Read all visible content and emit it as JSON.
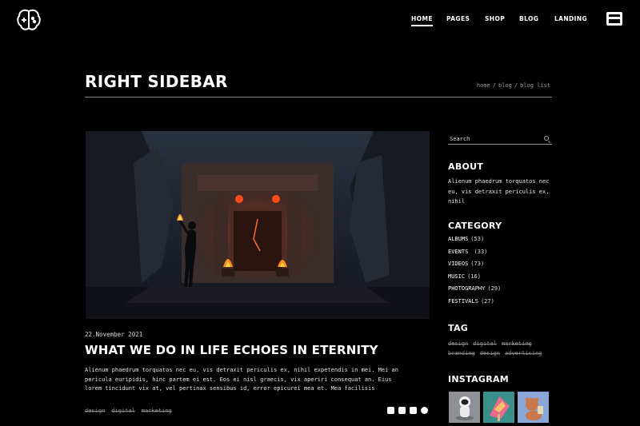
{
  "nav": {
    "items": [
      {
        "label": "HOME",
        "active": true
      },
      {
        "label": "PAGES"
      },
      {
        "label": "SHOP"
      },
      {
        "label": "BLOG"
      },
      {
        "label": "LANDING"
      }
    ]
  },
  "page": {
    "title": "RIGHT SIDEBAR",
    "breadcrumb": [
      "home",
      "blog",
      "blog list"
    ],
    "breadcrumb_separator": "/"
  },
  "post": {
    "date": "22.November 2021",
    "title": "WHAT WE DO IN LIFE ECHOES IN ETERNITY",
    "excerpt": "Alienum phaedrum torquatos nec eu, vis detraxit periculis ex, nihil expetendis in mei. Mei an pericula euripidis, hinc partem ei est. Eos ei nisl graecis, vix aperiri consequat an. Eius lorem tincidunt vix at, vel pertinax sensibus id, error epicurei mea et. Mea facilisis",
    "tags": [
      "design",
      "digital",
      "marketing"
    ],
    "social_icons": [
      "twitch-icon",
      "twitter-icon",
      "youtube-icon",
      "facebook-icon"
    ]
  },
  "sidebar": {
    "search_placeholder": "Search",
    "about": {
      "heading": "ABOUT",
      "text": "Alienum phaedrum torquatos nec eu, vis detraxit periculis ex, nihil"
    },
    "category": {
      "heading": "CATEGORY",
      "items": [
        {
          "label": "ALBUMS",
          "count": "(53)"
        },
        {
          "label": "EVENTS",
          "count": " (33)"
        },
        {
          "label": "VIDEOS",
          "count": "(73)"
        },
        {
          "label": "MUSIC",
          "count": "(16)"
        },
        {
          "label": "PHOTOGRAPHY",
          "count": "(29)"
        },
        {
          "label": "FESTIVALS",
          "count": "(27)"
        }
      ]
    },
    "tag": {
      "heading": "TAG",
      "items": [
        "design",
        "digital",
        "marketing",
        "branding",
        "design",
        "advertising"
      ]
    },
    "instagram": {
      "heading": "INSTAGRAM",
      "thumbs": [
        "astronaut-thumbnail",
        "ice-cream-thumbnail",
        "bear-thumbnail"
      ]
    }
  },
  "colors": {
    "background": "#000000",
    "text": "#ffffff",
    "muted": "#8c8c8c",
    "fire": "#ff5a1e"
  }
}
